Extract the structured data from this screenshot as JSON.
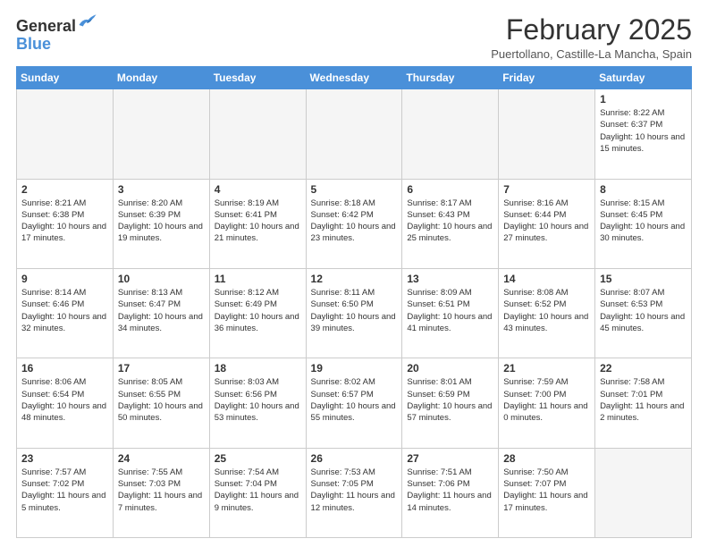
{
  "header": {
    "logo_general": "General",
    "logo_blue": "Blue",
    "month_title": "February 2025",
    "location": "Puertollano, Castille-La Mancha, Spain"
  },
  "weekdays": [
    "Sunday",
    "Monday",
    "Tuesday",
    "Wednesday",
    "Thursday",
    "Friday",
    "Saturday"
  ],
  "weeks": [
    [
      {
        "day": "",
        "empty": true
      },
      {
        "day": "",
        "empty": true
      },
      {
        "day": "",
        "empty": true
      },
      {
        "day": "",
        "empty": true
      },
      {
        "day": "",
        "empty": true
      },
      {
        "day": "",
        "empty": true
      },
      {
        "day": "1",
        "sunrise": "8:22 AM",
        "sunset": "6:37 PM",
        "daylight": "10 hours and 15 minutes."
      }
    ],
    [
      {
        "day": "2",
        "sunrise": "8:21 AM",
        "sunset": "6:38 PM",
        "daylight": "10 hours and 17 minutes."
      },
      {
        "day": "3",
        "sunrise": "8:20 AM",
        "sunset": "6:39 PM",
        "daylight": "10 hours and 19 minutes."
      },
      {
        "day": "4",
        "sunrise": "8:19 AM",
        "sunset": "6:41 PM",
        "daylight": "10 hours and 21 minutes."
      },
      {
        "day": "5",
        "sunrise": "8:18 AM",
        "sunset": "6:42 PM",
        "daylight": "10 hours and 23 minutes."
      },
      {
        "day": "6",
        "sunrise": "8:17 AM",
        "sunset": "6:43 PM",
        "daylight": "10 hours and 25 minutes."
      },
      {
        "day": "7",
        "sunrise": "8:16 AM",
        "sunset": "6:44 PM",
        "daylight": "10 hours and 27 minutes."
      },
      {
        "day": "8",
        "sunrise": "8:15 AM",
        "sunset": "6:45 PM",
        "daylight": "10 hours and 30 minutes."
      }
    ],
    [
      {
        "day": "9",
        "sunrise": "8:14 AM",
        "sunset": "6:46 PM",
        "daylight": "10 hours and 32 minutes."
      },
      {
        "day": "10",
        "sunrise": "8:13 AM",
        "sunset": "6:47 PM",
        "daylight": "10 hours and 34 minutes."
      },
      {
        "day": "11",
        "sunrise": "8:12 AM",
        "sunset": "6:49 PM",
        "daylight": "10 hours and 36 minutes."
      },
      {
        "day": "12",
        "sunrise": "8:11 AM",
        "sunset": "6:50 PM",
        "daylight": "10 hours and 39 minutes."
      },
      {
        "day": "13",
        "sunrise": "8:09 AM",
        "sunset": "6:51 PM",
        "daylight": "10 hours and 41 minutes."
      },
      {
        "day": "14",
        "sunrise": "8:08 AM",
        "sunset": "6:52 PM",
        "daylight": "10 hours and 43 minutes."
      },
      {
        "day": "15",
        "sunrise": "8:07 AM",
        "sunset": "6:53 PM",
        "daylight": "10 hours and 45 minutes."
      }
    ],
    [
      {
        "day": "16",
        "sunrise": "8:06 AM",
        "sunset": "6:54 PM",
        "daylight": "10 hours and 48 minutes."
      },
      {
        "day": "17",
        "sunrise": "8:05 AM",
        "sunset": "6:55 PM",
        "daylight": "10 hours and 50 minutes."
      },
      {
        "day": "18",
        "sunrise": "8:03 AM",
        "sunset": "6:56 PM",
        "daylight": "10 hours and 53 minutes."
      },
      {
        "day": "19",
        "sunrise": "8:02 AM",
        "sunset": "6:57 PM",
        "daylight": "10 hours and 55 minutes."
      },
      {
        "day": "20",
        "sunrise": "8:01 AM",
        "sunset": "6:59 PM",
        "daylight": "10 hours and 57 minutes."
      },
      {
        "day": "21",
        "sunrise": "7:59 AM",
        "sunset": "7:00 PM",
        "daylight": "11 hours and 0 minutes."
      },
      {
        "day": "22",
        "sunrise": "7:58 AM",
        "sunset": "7:01 PM",
        "daylight": "11 hours and 2 minutes."
      }
    ],
    [
      {
        "day": "23",
        "sunrise": "7:57 AM",
        "sunset": "7:02 PM",
        "daylight": "11 hours and 5 minutes."
      },
      {
        "day": "24",
        "sunrise": "7:55 AM",
        "sunset": "7:03 PM",
        "daylight": "11 hours and 7 minutes."
      },
      {
        "day": "25",
        "sunrise": "7:54 AM",
        "sunset": "7:04 PM",
        "daylight": "11 hours and 9 minutes."
      },
      {
        "day": "26",
        "sunrise": "7:53 AM",
        "sunset": "7:05 PM",
        "daylight": "11 hours and 12 minutes."
      },
      {
        "day": "27",
        "sunrise": "7:51 AM",
        "sunset": "7:06 PM",
        "daylight": "11 hours and 14 minutes."
      },
      {
        "day": "28",
        "sunrise": "7:50 AM",
        "sunset": "7:07 PM",
        "daylight": "11 hours and 17 minutes."
      },
      {
        "day": "",
        "empty": true
      }
    ]
  ]
}
